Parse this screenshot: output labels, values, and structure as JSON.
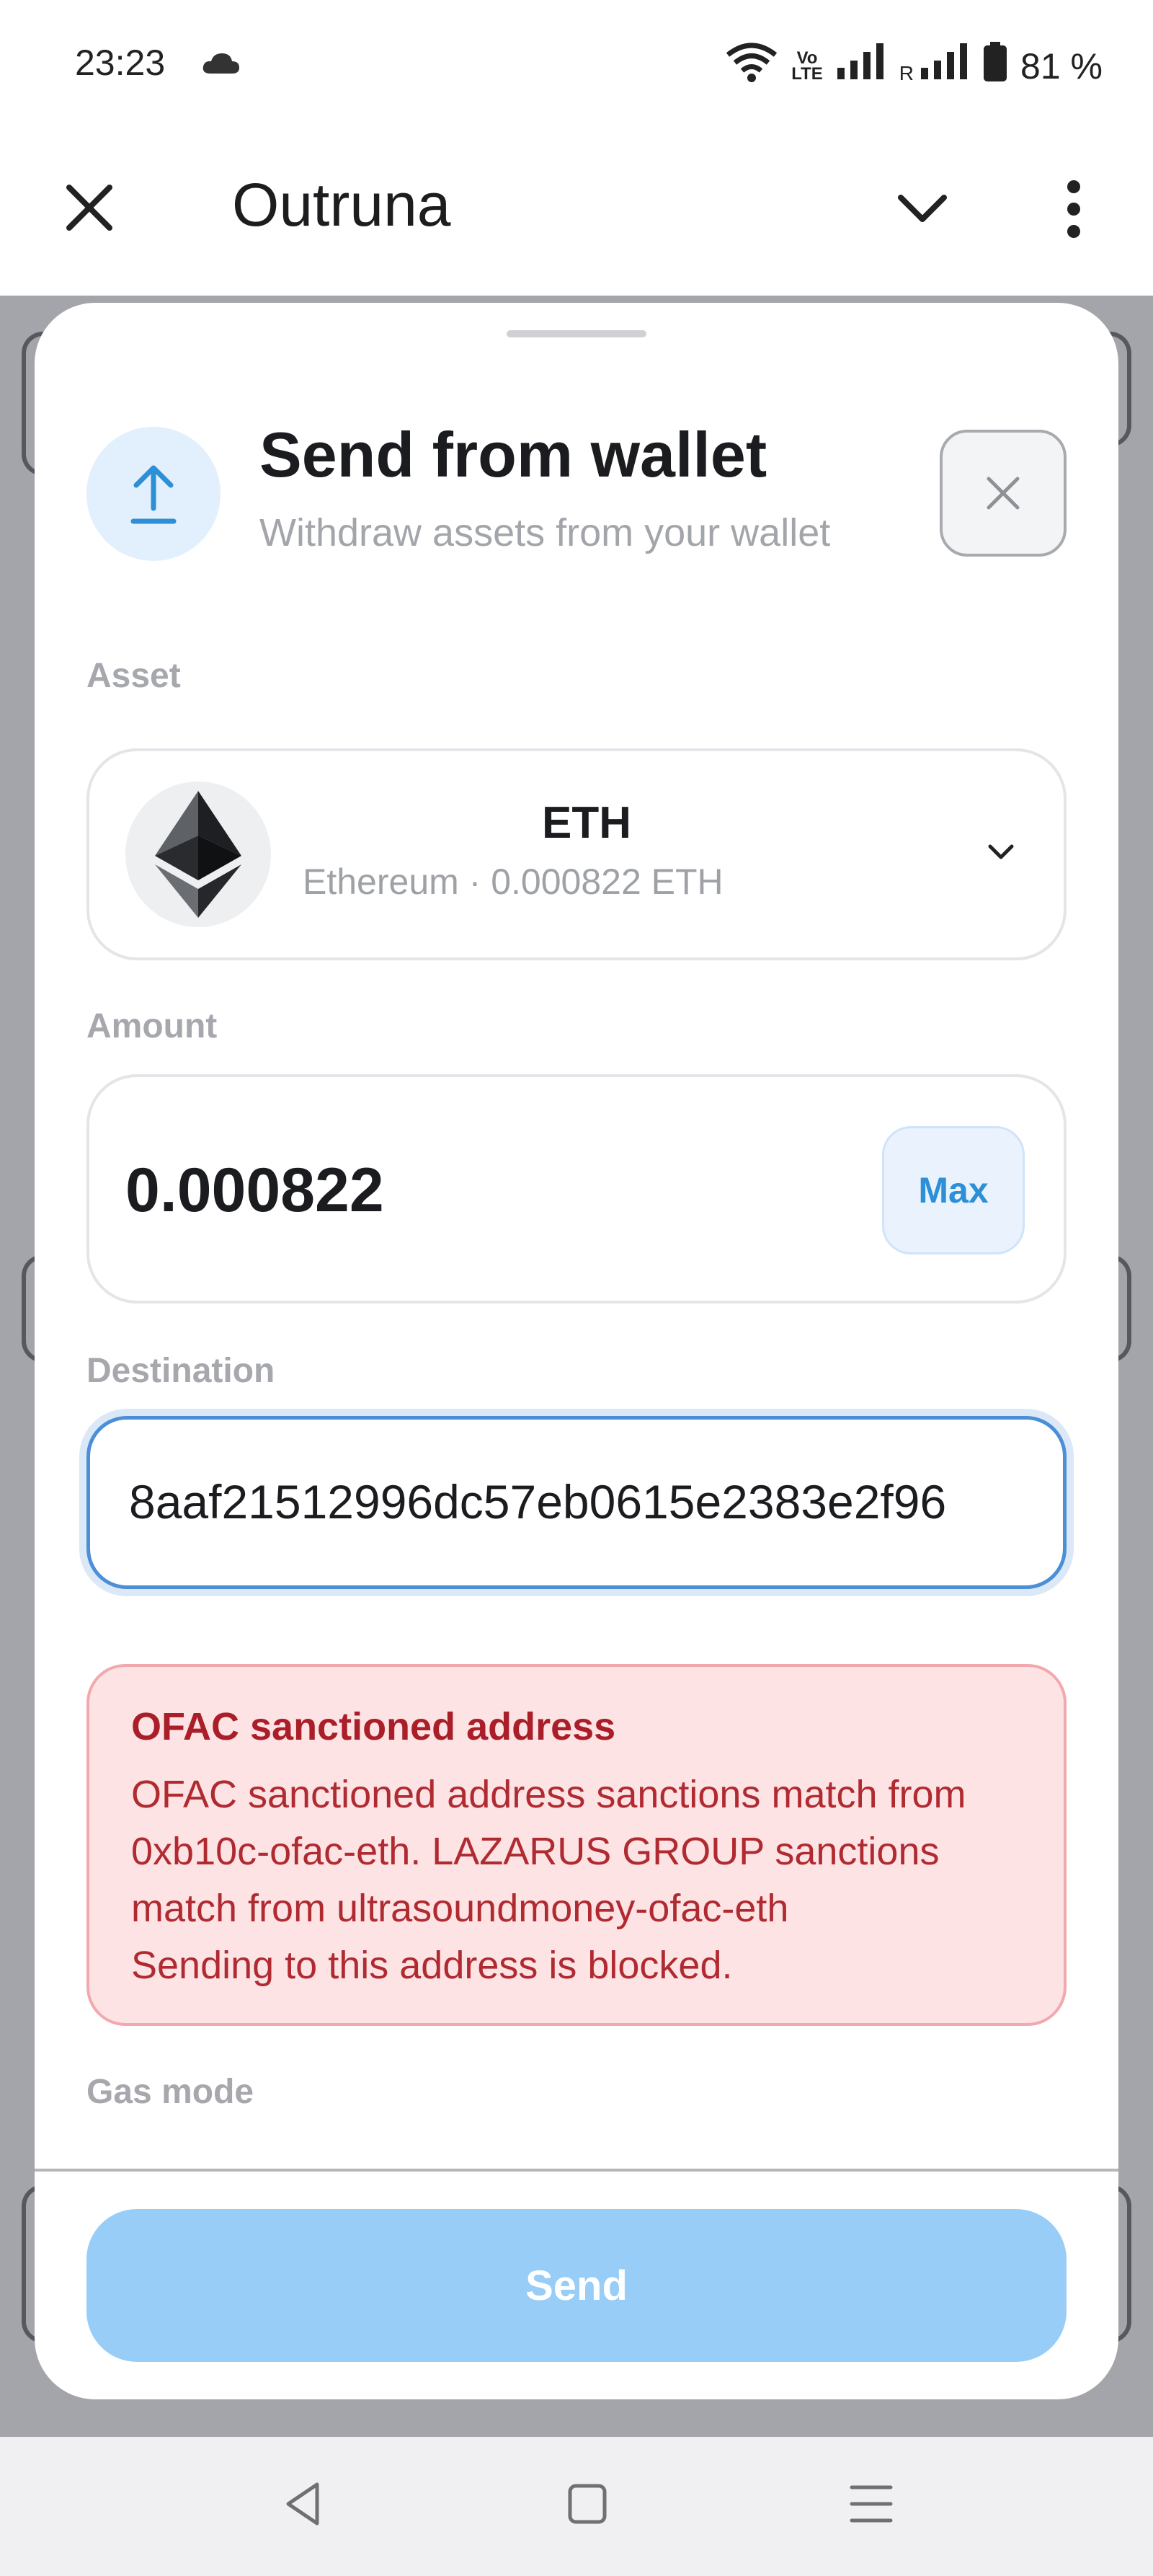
{
  "status_bar": {
    "time": "23:23",
    "volte_top": "Vo",
    "volte_bottom": "LTE",
    "roaming": "R",
    "battery": "81 %"
  },
  "app_bar": {
    "title": "Outruna",
    "icons": [
      "close-icon",
      "chevron-down-icon",
      "more-vert-icon"
    ]
  },
  "sheet": {
    "title": "Send from wallet",
    "subtitle": "Withdraw assets from your wallet",
    "asset": {
      "label": "Asset",
      "symbol": "ETH",
      "detail": "Ethereum · 0.000822 ETH"
    },
    "amount": {
      "label": "Amount",
      "value": "0.000822",
      "max_label": "Max"
    },
    "destination": {
      "label": "Destination",
      "value": "8aaf21512996dc57eb0615e2383e2f96"
    },
    "alert": {
      "title": "OFAC sanctioned address",
      "lines": [
        "OFAC sanctioned address sanctions match from",
        "0xb10c-ofac-eth. LAZARUS GROUP sanctions",
        "match from ultrasoundmoney-ofac-eth",
        "Sending to this address is blocked."
      ]
    },
    "gas_label": "Gas mode",
    "send_label": "Send"
  },
  "colors": {
    "accent": "#2d8fd6",
    "send_disabled": "#97cdf6",
    "alert_bg": "#fde3e4",
    "alert_text": "#a91e28"
  }
}
